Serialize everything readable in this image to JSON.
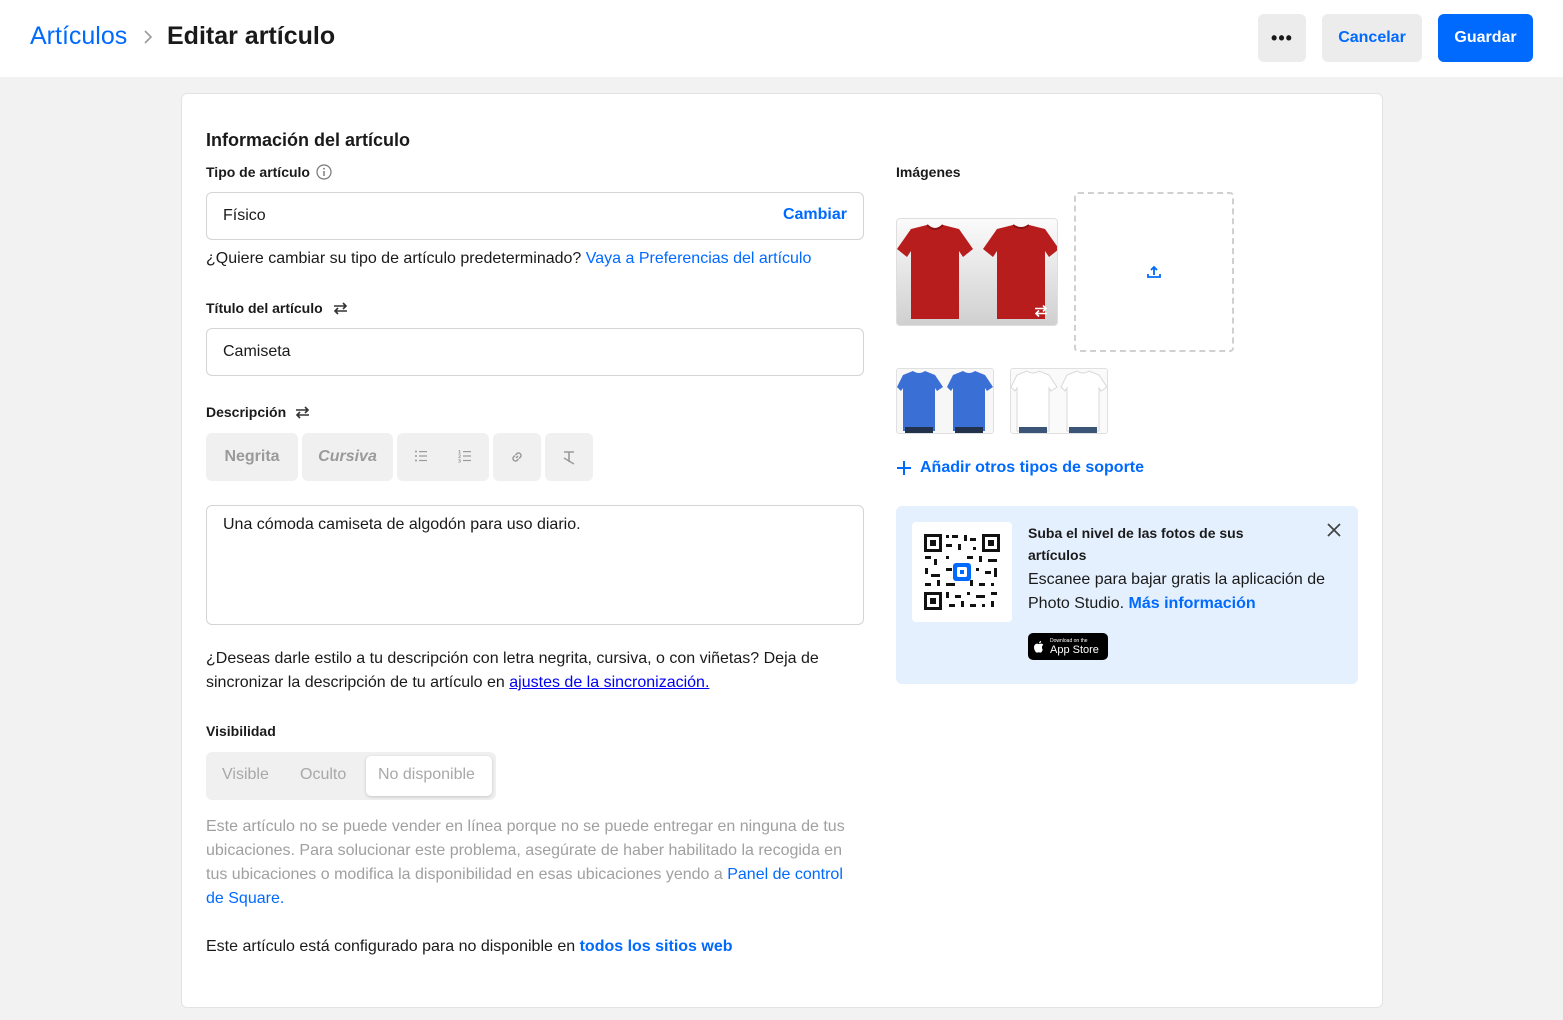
{
  "header": {
    "breadcrumb": "Artículos",
    "title": "Editar artículo",
    "more_label": "•••",
    "cancel_label": "Cancelar",
    "save_label": "Guardar"
  },
  "item_info": {
    "section_title": "Información del artículo",
    "type": {
      "label": "Tipo de artículo",
      "value": "Físico",
      "change_label": "Cambiar",
      "hint": "¿Quiere cambiar su tipo de artículo predeterminado?",
      "hint_link": "Vaya a Preferencias del artículo"
    },
    "title_field": {
      "label": "Título del artículo",
      "value": "Camiseta"
    },
    "description": {
      "label": "Descripción",
      "toolbar": {
        "bold": "Negrita",
        "italic": "Cursiva"
      },
      "value": "Una cómoda camiseta de algodón para uso diario.",
      "help_text": "¿Deseas darle estilo a tu descripción con letra negrita, cursiva, o con viñetas? Deja de sincronizar la descripción de tu artículo en",
      "help_link": "ajustes de la sincronización."
    },
    "visibility": {
      "label": "Visibilidad",
      "options": [
        "Visible",
        "Oculto",
        "No disponible"
      ],
      "selected": "No disponible",
      "note": "Este artículo no se puede vender en línea porque no se puede entregar en ninguna de tus ubicaciones. Para solucionar este problema, asegúrate de haber habilitado la recogida en tus ubicaciones o modifica la disponibilidad en esas ubicaciones yendo a",
      "note_link": "Panel de control de Square.",
      "status_text": "Este artículo está configurado para no disponible en",
      "status_link": "todos los sitios web"
    }
  },
  "images": {
    "label": "Imágenes",
    "main_image": "red-tshirt",
    "thumbnails": [
      "blue-tshirt",
      "white-tshirt"
    ],
    "add_media_label": "Añadir otros tipos de soporte"
  },
  "promo": {
    "title": "Suba el nivel de las fotos de sus artículos",
    "body": "Escanee para bajar gratis la aplicación de Photo Studio.",
    "link": "Más información",
    "badge_small": "Download on the",
    "badge_big": "App Store"
  },
  "colors": {
    "accent": "#006aff",
    "promo_bg": "#e5f0ff"
  }
}
